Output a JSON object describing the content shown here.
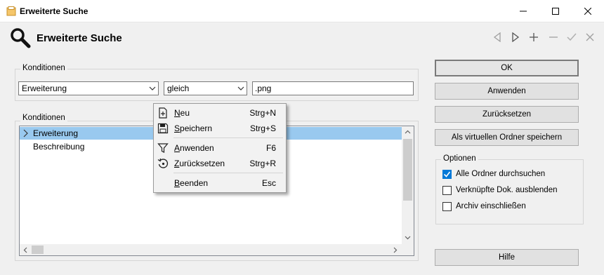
{
  "window": {
    "title": "Erweiterte Suche",
    "controls": {
      "minimize": "minimize-icon",
      "maximize": "maximize-icon",
      "close": "close-icon"
    }
  },
  "header": {
    "title": "Erweiterte Suche",
    "icon": "search-icon",
    "nav_icons": [
      "previous-icon",
      "next-icon",
      "add-icon",
      "remove-icon",
      "check-icon",
      "close-icon"
    ]
  },
  "conditions_top": {
    "label": "Konditionen",
    "field_combo": "Erweiterung",
    "operator_combo": "gleich",
    "value": ".png"
  },
  "conditions_list": {
    "label": "Konditionen",
    "rows": [
      {
        "text": "Erweiterung",
        "selected": true
      },
      {
        "text": "Beschreibung",
        "selected": false
      }
    ]
  },
  "context_menu": {
    "items": [
      {
        "first": "N",
        "rest": "eu",
        "shortcut": "Strg+N",
        "icon": "new-icon"
      },
      {
        "first": "S",
        "rest": "peichern",
        "shortcut": "Strg+S",
        "icon": "save-icon"
      },
      {
        "first": "A",
        "rest": "nwenden",
        "shortcut": "F6",
        "icon": "filter-icon"
      },
      {
        "first": "Z",
        "rest": "urücksetzen",
        "shortcut": "Strg+R",
        "icon": "reset-icon"
      },
      {
        "first": "B",
        "rest": "eenden",
        "shortcut": "Esc",
        "icon": ""
      }
    ]
  },
  "buttons": {
    "ok": "OK",
    "apply": "Anwenden",
    "reset": "Zurücksetzen",
    "save_virtual": "Als virtuellen Ordner speichern",
    "help": "Hilfe"
  },
  "options": {
    "label": "Optionen",
    "items": [
      {
        "label": "Alle Ordner durchsuchen",
        "checked": true
      },
      {
        "label": "Verknüpfte Dok. ausblenden",
        "checked": false
      },
      {
        "label": "Archiv einschließen",
        "checked": false
      }
    ]
  },
  "colors": {
    "selection": "#99c9ef",
    "checkbox_accent": "#0078d7",
    "window_bg": "#f0f0f0"
  }
}
